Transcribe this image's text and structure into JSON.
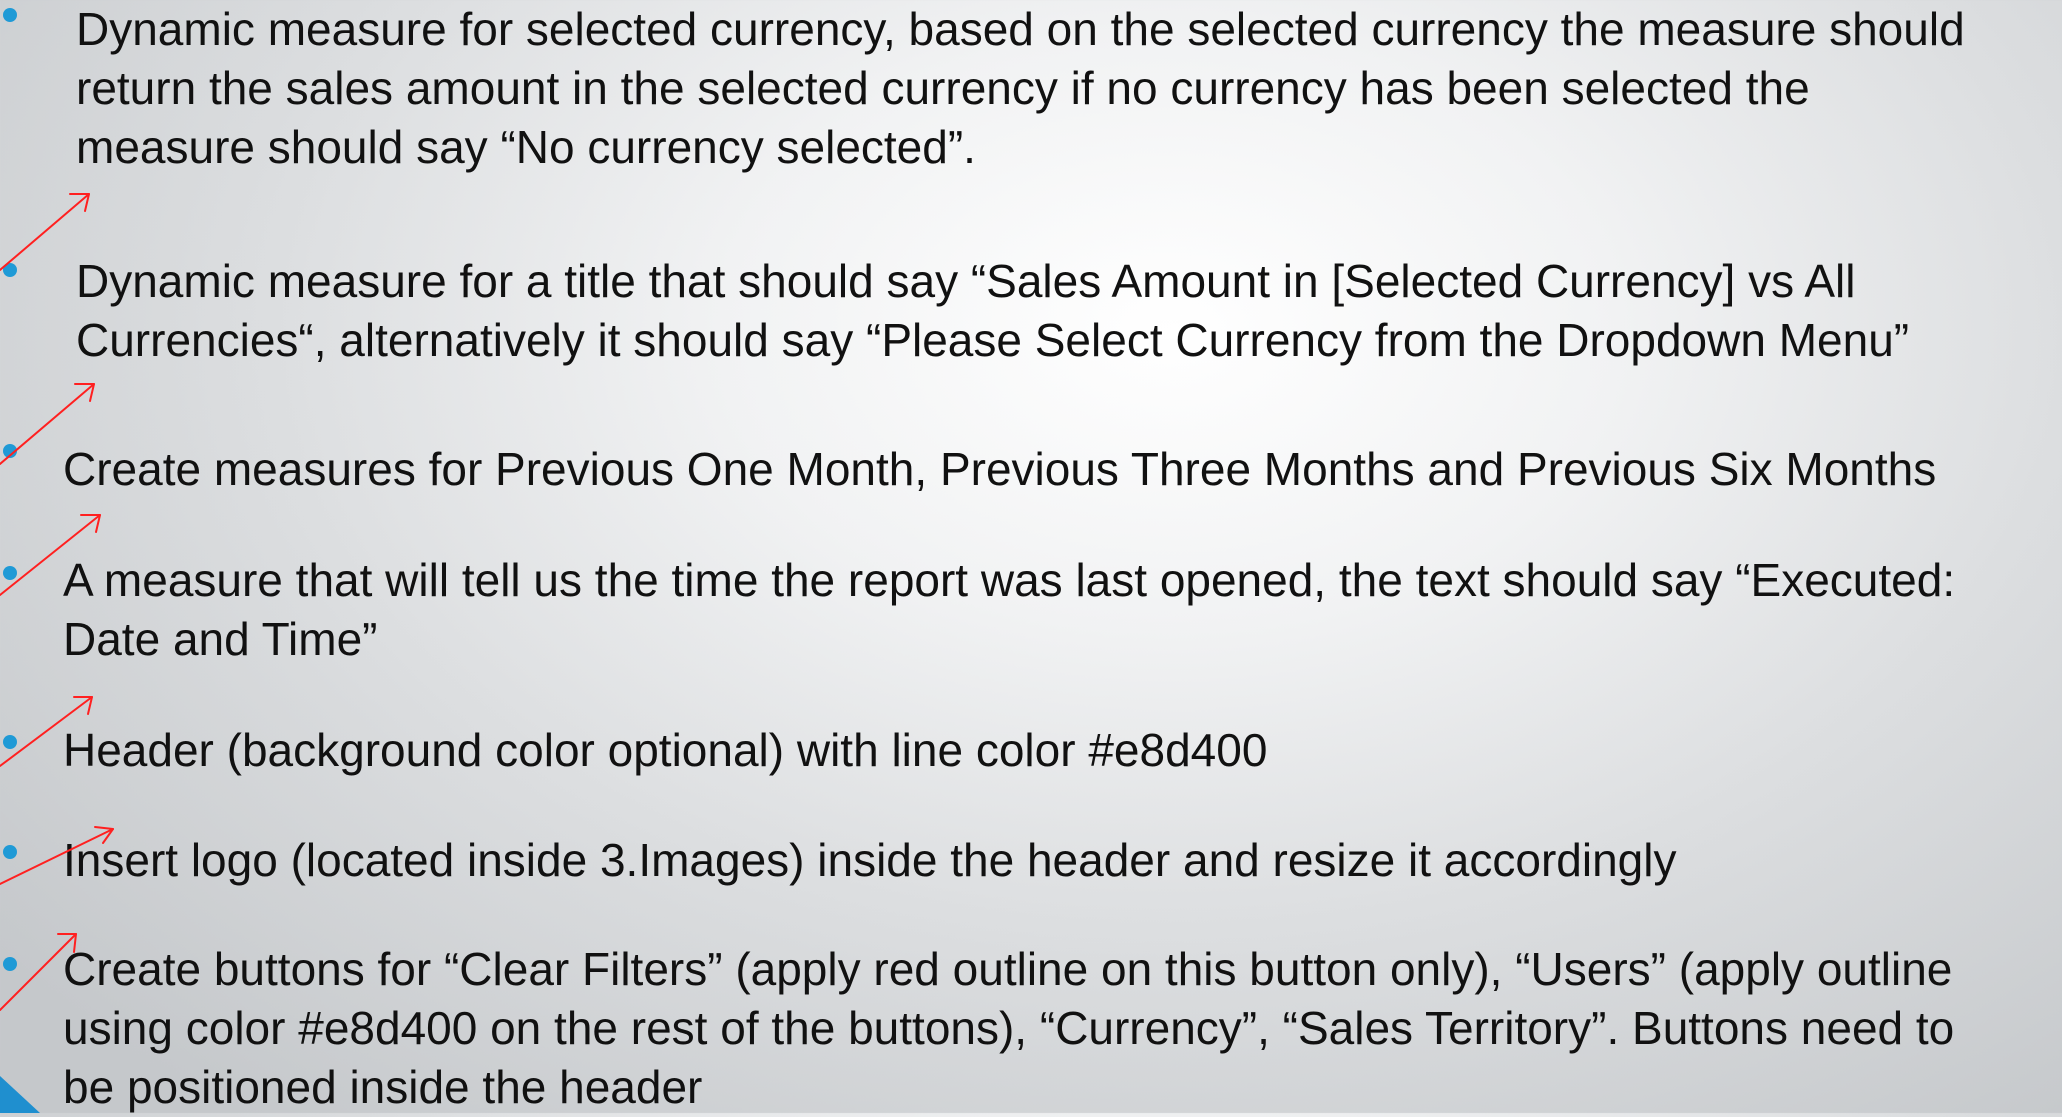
{
  "bullets": [
    {
      "lines": [
        "Dynamic measure for selected currency, based on the selected currency the measure should",
        "return the sales amount in the selected currency if no currency has been selected the",
        "measure should say “No currency selected”."
      ]
    },
    {
      "lines": [
        "Dynamic measure for a title that should say “Sales Amount in [Selected Currency] vs All",
        "Currencies“, alternatively it should say “Please Select Currency from the Dropdown Menu”"
      ]
    },
    {
      "lines": [
        "Create measures for Previous One Month, Previous Three Months and Previous Six Months"
      ]
    },
    {
      "lines": [
        "A measure that will tell us the time the report was last opened, the text should say “Executed:",
        "Date and Time”"
      ]
    },
    {
      "lines": [
        "Header (background color optional) with line color #e8d400"
      ]
    },
    {
      "lines": [
        "Insert logo (located inside 3.Images) inside the header and resize it accordingly"
      ]
    },
    {
      "lines": [
        "Create buttons for “Clear Filters” (apply red outline on this button only), “Users” (apply outline",
        "using color #e8d400 on the rest of the buttons), “Currency”, “Sales Territory”. Buttons need to",
        "be positioned inside the header"
      ]
    }
  ],
  "colors": {
    "bullet": "#1f9ad6",
    "annotation_arrow": "#ff2020",
    "corner_accent": "#1f8fcf"
  },
  "icons": {
    "bullet": "bullet-dot-icon",
    "annotation": "red-arrow-icon",
    "corner": "corner-triangle-icon"
  }
}
